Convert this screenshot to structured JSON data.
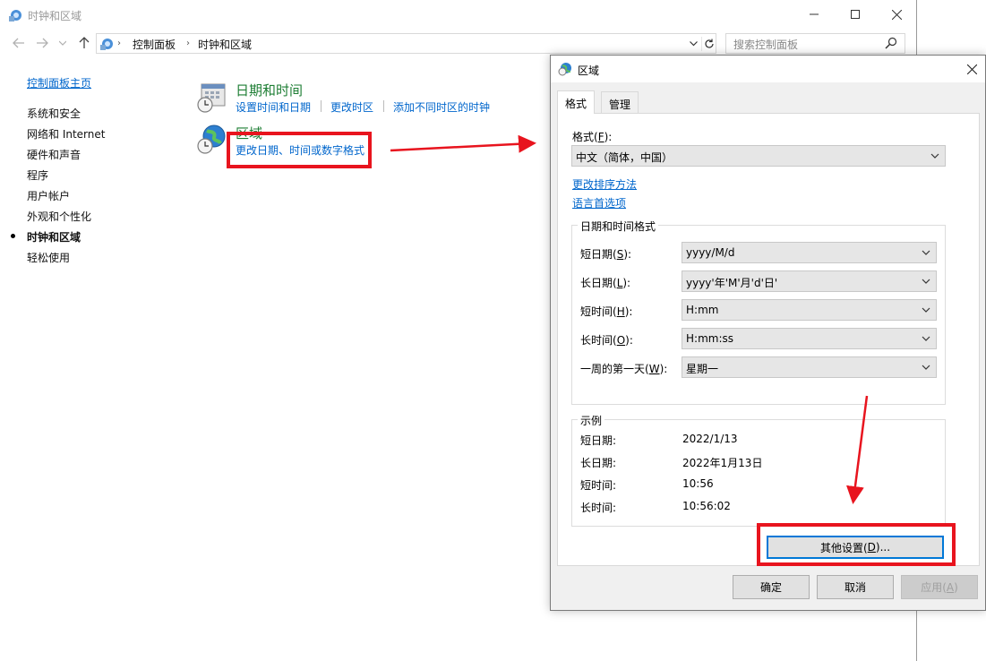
{
  "window": {
    "title": "时钟和区域",
    "controls": [
      "minimize-icon",
      "maximize-icon",
      "close-icon"
    ]
  },
  "address_bar": {
    "breadcrumbs": [
      "控制面板",
      "时钟和区域"
    ],
    "search_placeholder": "搜索控制面板"
  },
  "left_nav": {
    "home": "控制面板主页",
    "items": [
      {
        "label": "系统和安全",
        "current": false
      },
      {
        "label": "网络和 Internet",
        "current": false
      },
      {
        "label": "硬件和声音",
        "current": false
      },
      {
        "label": "程序",
        "current": false
      },
      {
        "label": "用户帐户",
        "current": false
      },
      {
        "label": "外观和个性化",
        "current": false
      },
      {
        "label": "时钟和区域",
        "current": true
      },
      {
        "label": "轻松使用",
        "current": false
      }
    ]
  },
  "categories": [
    {
      "title": "日期和时间",
      "icon": "calendar-clock-icon",
      "links": [
        "设置时间和日期",
        "更改时区",
        "添加不同时区的时钟"
      ]
    },
    {
      "title": "区域",
      "icon": "globe-clock-icon",
      "links": [
        "更改日期、时间或数字格式"
      ]
    }
  ],
  "dialog": {
    "title": "区域",
    "tabs": [
      "格式",
      "管理"
    ],
    "format_label": "格式(F):",
    "format_label_pre": "格式(",
    "format_label_key": "F",
    "format_label_post": "):",
    "format_value": "中文（简体，中国）",
    "links": [
      "更改排序方法",
      "语言首选项"
    ],
    "datetime_group_title": "日期和时间格式",
    "fields": [
      {
        "pre": "短日期(",
        "key": "S",
        "post": "):",
        "value": "yyyy/M/d"
      },
      {
        "pre": "长日期(",
        "key": "L",
        "post": "):",
        "value": "yyyy'年'M'月'd'日'"
      },
      {
        "pre": "短时间(",
        "key": "H",
        "post": "):",
        "value": "H:mm"
      },
      {
        "pre": "长时间(",
        "key": "O",
        "post": "):",
        "value": "H:mm:ss"
      },
      {
        "pre": "一周的第一天(",
        "key": "W",
        "post": "):",
        "value": "星期一"
      }
    ],
    "examples_group_title": "示例",
    "examples": [
      {
        "label": "短日期:",
        "value": "2022/1/13"
      },
      {
        "label": "长日期:",
        "value": "2022年1月13日"
      },
      {
        "label": "短时间:",
        "value": "10:56"
      },
      {
        "label": "长时间:",
        "value": "10:56:02"
      }
    ],
    "other_settings": {
      "pre": "其他设置(",
      "key": "D",
      "post": ")..."
    },
    "buttons": {
      "ok": "确定",
      "cancel": "取消",
      "apply_pre": "应用(",
      "apply_key": "A",
      "apply_post": ")"
    }
  },
  "colors": {
    "link": "#0066cc",
    "category_title": "#1e7e34",
    "highlight": "#e8141e",
    "focus": "#0078d7"
  }
}
